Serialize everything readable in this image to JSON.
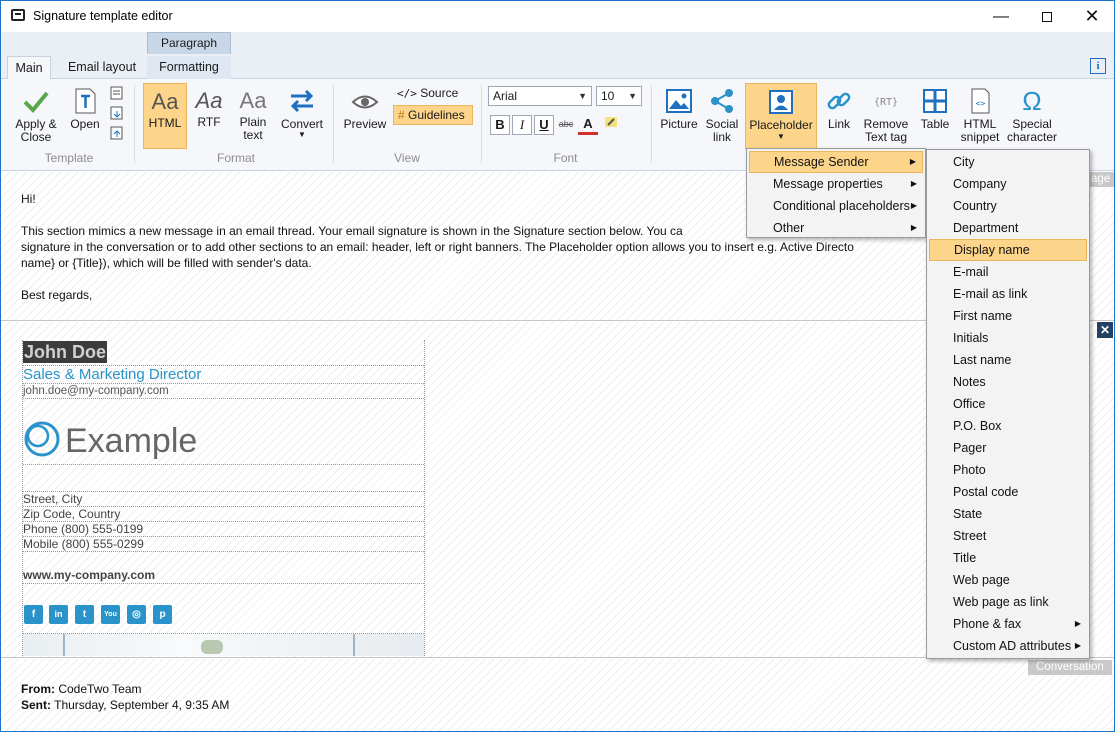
{
  "window": {
    "title": "Signature template editor",
    "context_tab": "Paragraph",
    "controls": {
      "minimize": "—",
      "maximize": "",
      "close": "✕"
    }
  },
  "tabs": [
    {
      "label": "Main",
      "active": true
    },
    {
      "label": "Email layout",
      "active": false
    },
    {
      "label": "Formatting",
      "active": false
    }
  ],
  "info_label": "i",
  "ribbon": {
    "template": {
      "label": "Template",
      "apply_close": "Apply &\nClose",
      "open": "Open"
    },
    "format": {
      "label": "Format",
      "html": "HTML",
      "rtf": "RTF",
      "plain_text": "Plain\ntext",
      "convert": "Convert",
      "aa": "Aa"
    },
    "view": {
      "label": "View",
      "preview": "Preview",
      "source": "Source",
      "guidelines": "Guidelines"
    },
    "font": {
      "label": "Font",
      "family": "Arial",
      "size": "10",
      "bold": "B",
      "italic": "I",
      "underline": "U",
      "strike": "abc",
      "color": "A"
    },
    "insert": {
      "picture": "Picture",
      "social_link": "Social\nlink",
      "placeholder": "Placeholder",
      "link": "Link",
      "remove_text_tag": "Remove\nText tag",
      "table": "Table",
      "html_snippet": "HTML\nsnippet",
      "special_character": "Special\ncharacter"
    }
  },
  "message": {
    "greeting": "Hi!",
    "body_line1": "This section mimics a new message in an email thread. Your email signature is shown in the Signature section below. You ca",
    "body_line2": "signature in the conversation or to add other sections to an email: header, left or right banners. The Placeholder option allows you to insert e.g. Active Directo",
    "body_line3": "name} or {Title}), which will be filled with sender's data.",
    "closing": "Best regards,",
    "section_label": "age"
  },
  "signature": {
    "name": "John Doe",
    "title": "Sales & Marketing Director",
    "email": "john.doe@my-company.com",
    "logo_text": "Example",
    "street": "Street, City",
    "zip": "Zip Code, Country",
    "phone": "Phone (800) 555-0199",
    "mobile": "Mobile (800) 555-0299",
    "website": "www.my-company.com",
    "social": [
      "f",
      "in",
      "t",
      "You",
      "◎",
      "p"
    ]
  },
  "conversation": {
    "label": "Conversation",
    "from_label": "From:",
    "from_value": " CodeTwo Team",
    "sent_label": "Sent:",
    "sent_value": " Thursday, September 4, 9:35 AM"
  },
  "placeholder_menu": [
    {
      "label": "Message Sender",
      "submenu": true,
      "selected": true
    },
    {
      "label": "Message properties",
      "submenu": true,
      "selected": false
    },
    {
      "label": "Conditional placeholders",
      "submenu": true,
      "selected": false
    },
    {
      "label": "Other",
      "submenu": true,
      "selected": false
    }
  ],
  "sender_menu": [
    {
      "label": "City",
      "submenu": false
    },
    {
      "label": "Company",
      "submenu": false
    },
    {
      "label": "Country",
      "submenu": false
    },
    {
      "label": "Department",
      "submenu": false
    },
    {
      "label": "Display name",
      "submenu": false,
      "selected": true
    },
    {
      "label": "E-mail",
      "submenu": false
    },
    {
      "label": "E-mail as link",
      "submenu": false
    },
    {
      "label": "First name",
      "submenu": false
    },
    {
      "label": "Initials",
      "submenu": false
    },
    {
      "label": "Last name",
      "submenu": false
    },
    {
      "label": "Notes",
      "submenu": false
    },
    {
      "label": "Office",
      "submenu": false
    },
    {
      "label": "P.O. Box",
      "submenu": false
    },
    {
      "label": "Pager",
      "submenu": false
    },
    {
      "label": "Photo",
      "submenu": false
    },
    {
      "label": "Postal code",
      "submenu": false
    },
    {
      "label": "State",
      "submenu": false
    },
    {
      "label": "Street",
      "submenu": false
    },
    {
      "label": "Title",
      "submenu": false
    },
    {
      "label": "Web page",
      "submenu": false
    },
    {
      "label": "Web page as link",
      "submenu": false
    },
    {
      "label": "Phone & fax",
      "submenu": true
    },
    {
      "label": "Custom AD attributes",
      "submenu": true
    }
  ],
  "colors": {
    "accent": "#2a93c9",
    "highlight": "#fcd48a",
    "window_border": "#1a73c6"
  }
}
